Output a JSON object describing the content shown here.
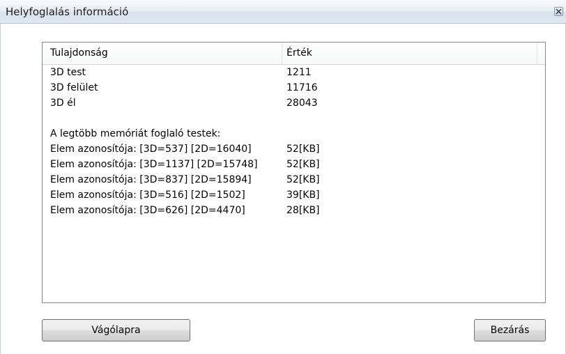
{
  "window": {
    "title": "Helyfoglalás információ"
  },
  "list": {
    "columns": [
      "Tulajdonság",
      "Érték"
    ],
    "rows": [
      {
        "property": "3D test",
        "value": "1211"
      },
      {
        "property": "3D felület",
        "value": "11716"
      },
      {
        "property": "3D él",
        "value": "28043"
      },
      {
        "property": "",
        "value": ""
      },
      {
        "property": "A legtöbb memóriát foglaló testek:",
        "value": ""
      },
      {
        "property": "Elem azonosítója: [3D=537] [2D=16040]",
        "value": "52[KB]"
      },
      {
        "property": "Elem azonosítója: [3D=1137] [2D=15748]",
        "value": "52[KB]"
      },
      {
        "property": "Elem azonosítója: [3D=837] [2D=15894]",
        "value": "52[KB]"
      },
      {
        "property": "Elem azonosítója: [3D=516] [2D=1502]",
        "value": "39[KB]"
      },
      {
        "property": "Elem azonosítója: [3D=626] [2D=4470]",
        "value": "28[KB]"
      }
    ]
  },
  "buttons": {
    "copy_label": "Vágólapra",
    "close_label": "Bezárás"
  },
  "icons": {
    "close": "close-icon"
  },
  "colors": {
    "titlebar": "#dfe7f1",
    "border": "#828790",
    "button": "#e5e5e5"
  }
}
